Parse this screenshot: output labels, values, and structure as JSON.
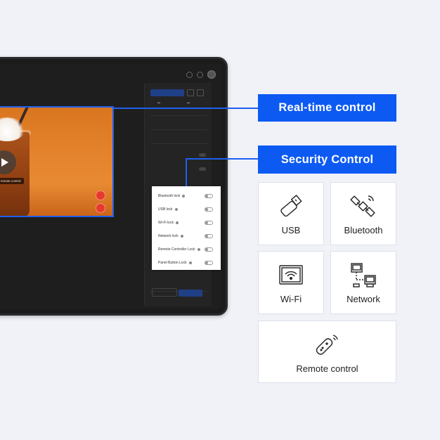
{
  "callouts": {
    "realtime": "Real-time control",
    "security": "Security Control"
  },
  "video": {
    "label": "Start remote control"
  },
  "lock_popup": {
    "items": [
      {
        "label": "Bluetooth lock"
      },
      {
        "label": "USB lock"
      },
      {
        "label": "Wi-Fi lock"
      },
      {
        "label": "Network lock"
      },
      {
        "label": "Remote Controller Lock"
      },
      {
        "label": "Panel Button Lock"
      }
    ]
  },
  "cards": {
    "usb": {
      "label": "USB",
      "icon": "usb-icon"
    },
    "bluetooth": {
      "label": "Bluetooth",
      "icon": "bluetooth-satellite-icon"
    },
    "wifi": {
      "label": "Wi-Fi",
      "icon": "wifi-icon"
    },
    "network": {
      "label": "Network",
      "icon": "network-icon"
    },
    "remote": {
      "label": "Remote control",
      "icon": "remote-control-icon"
    }
  },
  "colors": {
    "accent": "#0d5af3",
    "background": "#f0f2f8",
    "device": "#1b1b1b",
    "record": "#e53a2c"
  }
}
